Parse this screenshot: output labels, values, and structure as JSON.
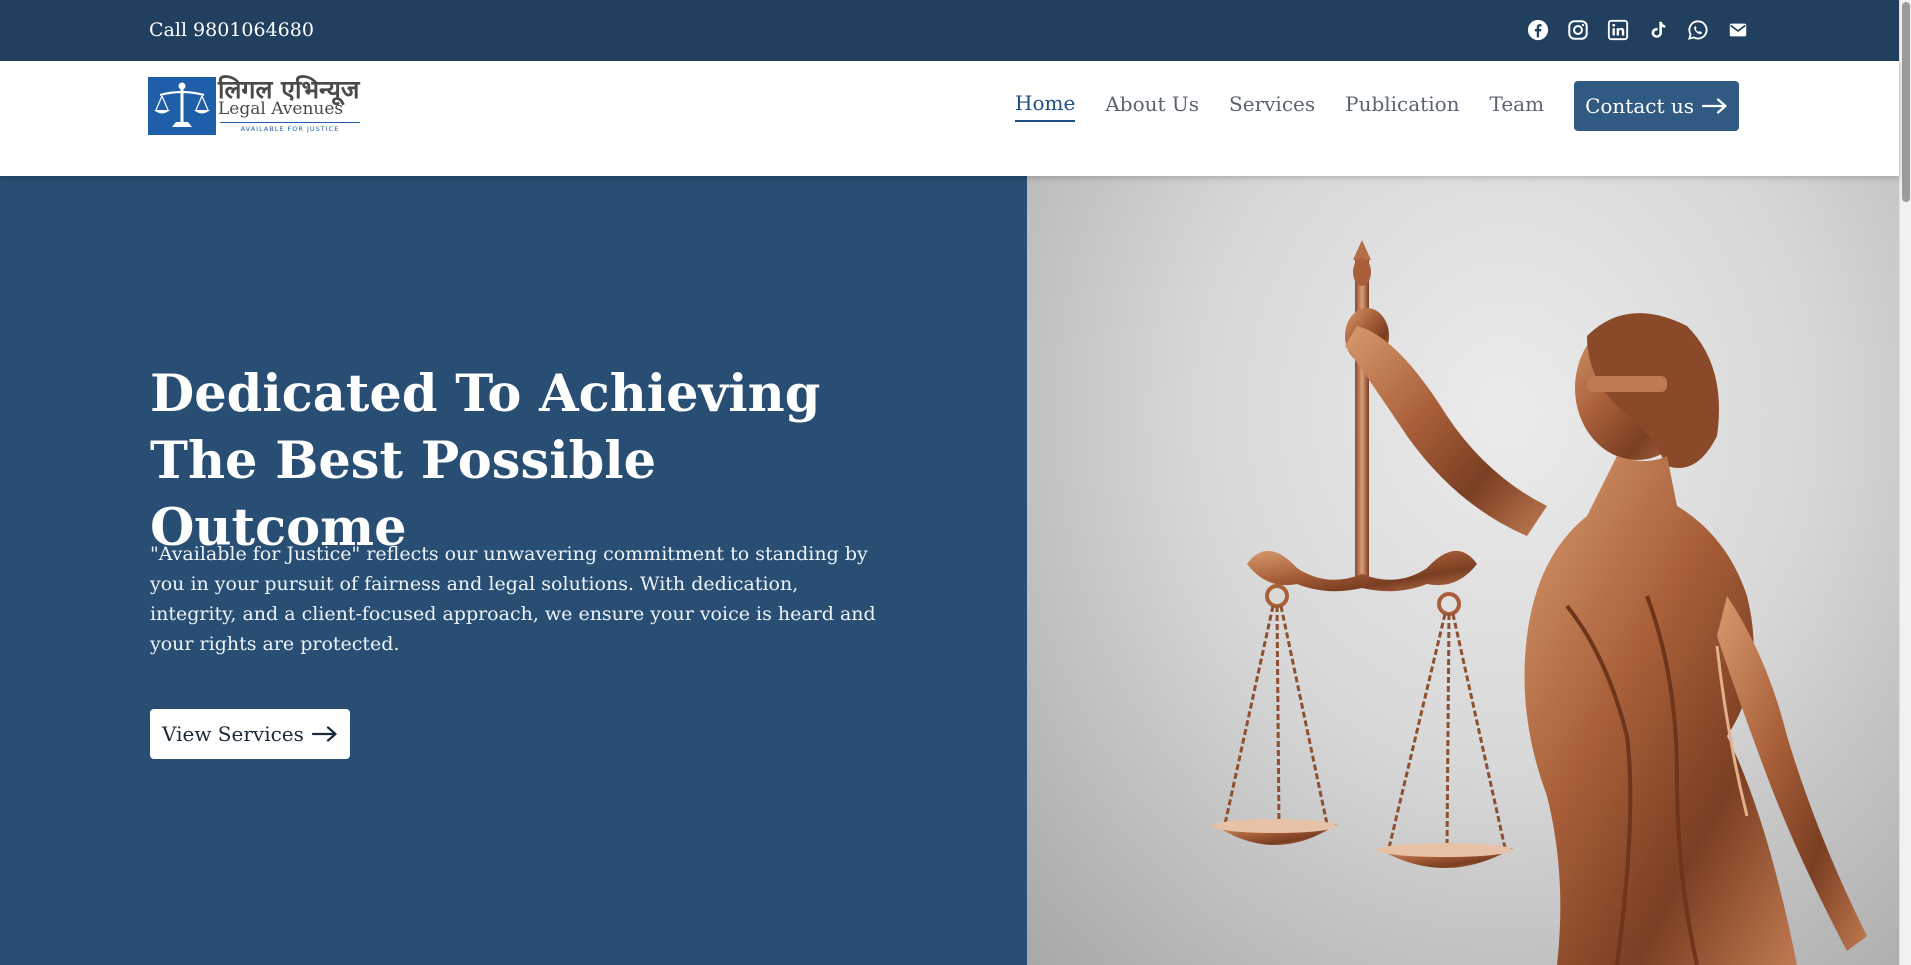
{
  "topbar": {
    "phone": "Call 9801064680",
    "socials": [
      "facebook-icon",
      "instagram-icon",
      "linkedin-icon",
      "tiktok-icon",
      "whatsapp-icon",
      "email-icon"
    ]
  },
  "logo": {
    "devanagari": "लिगल एभिन्यूज",
    "english": "Legal Avenues",
    "tagline": "AVAILABLE FOR JUSTICE"
  },
  "nav": {
    "items": [
      {
        "label": "Home",
        "active": true
      },
      {
        "label": "About Us"
      },
      {
        "label": "Services"
      },
      {
        "label": "Publication"
      },
      {
        "label": "Team"
      }
    ],
    "contact_label": "Contact us"
  },
  "hero": {
    "title": "Dedicated To Achieving The Best Possible Outcome",
    "text": "\"Available for Justice\" reflects our unwavering commitment to standing by you in your pursuit of fairness and legal solutions. With dedication, integrity, and a client-focused approach, we ensure your voice is heard and your rights are protected.",
    "button_label": "View Services",
    "image": "lady-justice-statue"
  },
  "colors": {
    "topbar": "#21405f",
    "hero_panel": "#284e73",
    "accent": "#315a82",
    "active_link": "#1e4e86"
  }
}
